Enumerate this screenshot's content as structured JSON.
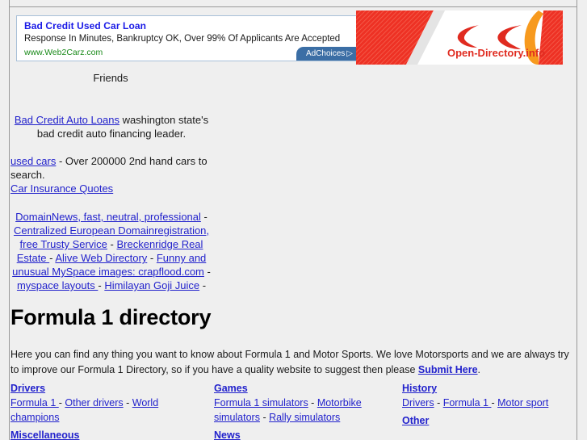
{
  "text_ad": {
    "title": "Bad Credit Used Car Loan",
    "description": "Response In Minutes, Bankruptcy OK, Over 99% Of Applicants Are Accepted",
    "url": "www.Web2Carz.com",
    "adchoices_label": "AdChoices",
    "adchoices_glyph": "▷",
    "title_color": "#1a1ae6",
    "url_color": "#1a8a1a",
    "badge_color": "#3b6ea5"
  },
  "banner": {
    "text": "Open-Directory.info",
    "primary_color": "#ee3124",
    "accent_color": "#f79a1e",
    "background": "#ffffff"
  },
  "friends": {
    "heading": "Friends",
    "line1_link": "Bad Credit Auto Loans",
    "line1_text": " washington state's bad credit auto financing leader.",
    "line2_link": "used cars",
    "line2_text": " - Over 200000 2nd hand cars to search.",
    "line3_link": "Car Insurance Quotes",
    "partner_links": [
      "DomainNews, fast, neutral, professional",
      "Centralized European Domainregistration, free Trusty Service",
      "Breckenridge Real Estate ",
      "Alive Web Directory",
      "Funny and unusual MySpace images: crapflood.com",
      "myspace layouts ",
      "Himilayan Goji Juice"
    ],
    "separator": " - "
  },
  "main": {
    "title": "Formula 1 directory",
    "intro_before": "Here you can find any thing you want to know about Formula 1 and Motor Sports. We love Motorsports and we are always try to improve our Formula 1 Directory, so if you have a quality website to suggest then please ",
    "intro_link": "Submit Here",
    "intro_after": "."
  },
  "directory": {
    "separator": " - ",
    "columns": [
      {
        "blocks": [
          {
            "heading": "Drivers",
            "links": [
              "Formula 1 ",
              "Other drivers",
              "World champions"
            ]
          },
          {
            "heading": "Miscellaneous",
            "links": []
          }
        ]
      },
      {
        "blocks": [
          {
            "heading": "Games",
            "links": [
              "Formula 1 simulators",
              "Motorbike simulators",
              "Rally simulators"
            ]
          },
          {
            "heading": "News",
            "links": []
          }
        ]
      },
      {
        "blocks": [
          {
            "heading": "History",
            "links": [
              "Drivers",
              "Formula 1 ",
              "Motor sport"
            ]
          },
          {
            "heading": "Other",
            "links": []
          }
        ]
      }
    ]
  }
}
